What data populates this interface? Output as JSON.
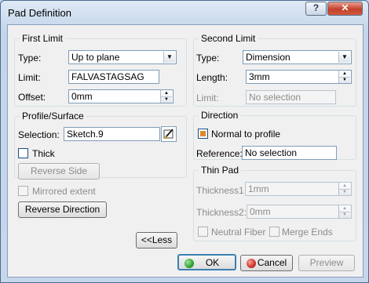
{
  "window": {
    "title": "Pad Definition",
    "help_glyph": "?",
    "close_glyph": "✕"
  },
  "first_limit": {
    "title": "First Limit",
    "type_label": "Type:",
    "type_value": "Up to plane",
    "limit_label": "Limit:",
    "limit_value": "FALVASTAGSAG",
    "offset_label": "Offset:",
    "offset_value": "0mm"
  },
  "profile_surface": {
    "title": "Profile/Surface",
    "selection_label": "Selection:",
    "selection_value": "Sketch.9",
    "thick_label": "Thick",
    "reverse_side_label": "Reverse Side"
  },
  "mirrored_extent_label": "Mirrored extent",
  "reverse_direction_label": "Reverse Direction",
  "less_button_label": "<<Less",
  "second_limit": {
    "title": "Second Limit",
    "type_label": "Type:",
    "type_value": "Dimension",
    "length_label": "Length:",
    "length_value": "3mm",
    "limit_label": "Limit:",
    "limit_value": "No selection"
  },
  "direction": {
    "title": "Direction",
    "normal_to_profile_label": "Normal to profile",
    "reference_label": "Reference:",
    "reference_value": "No selection"
  },
  "thin_pad": {
    "title": "Thin Pad",
    "thickness1_label": "Thickness1",
    "thickness1_value": "1mm",
    "thickness2_label": "Thickness2:",
    "thickness2_value": "0mm",
    "neutral_fiber_label": "Neutral Fiber",
    "merge_ends_label": "Merge Ends"
  },
  "footer": {
    "ok_label": "OK",
    "cancel_label": "Cancel",
    "preview_label": "Preview"
  },
  "colors": {
    "ok_icon": "#2fa12f",
    "cancel_icon": "#d2322a",
    "check_fill": "#e08a2a"
  }
}
